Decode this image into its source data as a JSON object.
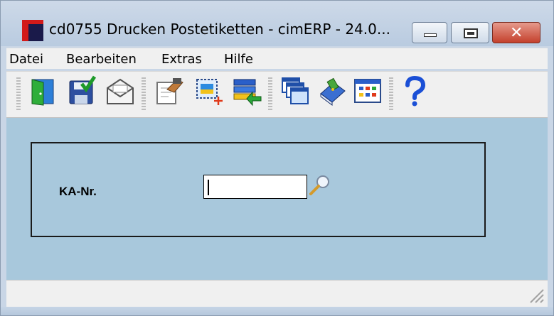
{
  "window": {
    "title": "cd0755 Drucken Postetiketten - cimERP - 24.0...",
    "minimize_glyph": "",
    "close_glyph": "✕"
  },
  "menu": {
    "items": [
      {
        "label": "Datei"
      },
      {
        "label": "Bearbeiten"
      },
      {
        "label": "Extras"
      },
      {
        "label": "Hilfe"
      }
    ]
  },
  "toolbar": {
    "buttons": [
      {
        "icon": "exit-door-icon"
      },
      {
        "icon": "save-check-icon"
      },
      {
        "icon": "mail-envelope-icon"
      },
      {
        "icon": "print-setup-icon"
      },
      {
        "icon": "select-area-add-icon"
      },
      {
        "icon": "list-transfer-icon"
      },
      {
        "icon": "windows-stack-icon"
      },
      {
        "icon": "book-tag-icon"
      },
      {
        "icon": "calendar-grid-icon"
      },
      {
        "icon": "help-question-icon"
      }
    ]
  },
  "form": {
    "ka_label": "KA-Nr.",
    "ka_value": ""
  },
  "colors": {
    "client_bg": "#a8c8dc",
    "close_button": "#c4402c",
    "help_blue": "#1a4fd6"
  }
}
